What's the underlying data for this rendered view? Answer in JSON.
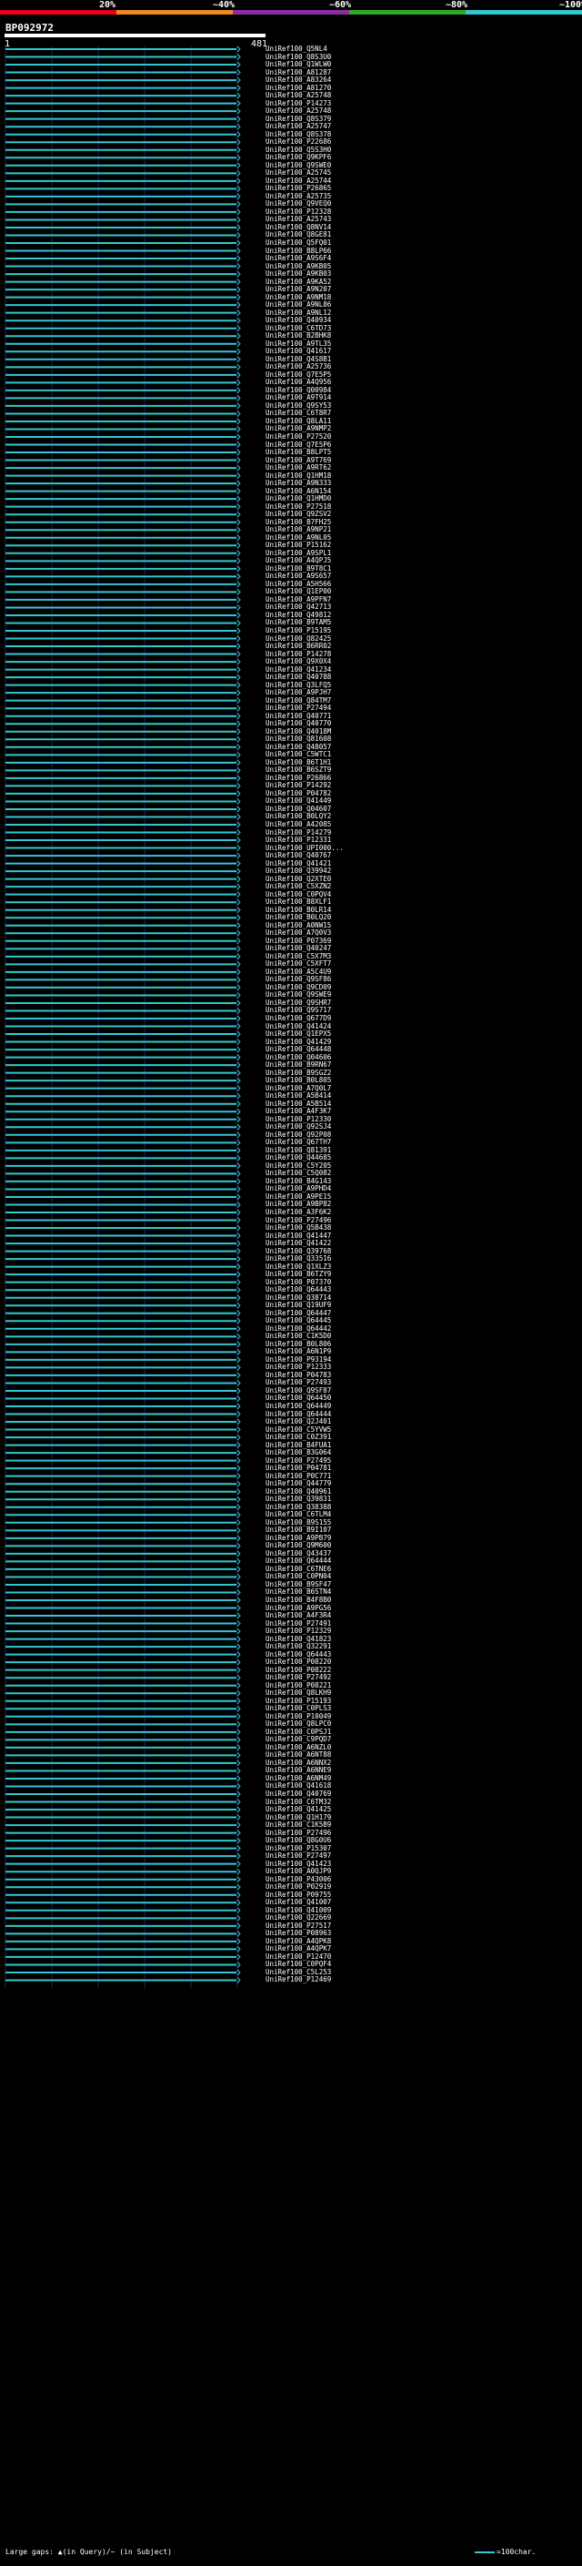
{
  "scale": {
    "labels": [
      "20%",
      "~40%",
      "~60%",
      "~80%",
      "~100%"
    ],
    "colors": [
      "#e8001c",
      "#f08a1e",
      "#8c2ca0",
      "#2fa82f",
      "#32c8d2"
    ]
  },
  "query": {
    "id": "BP092972",
    "start": "1",
    "end": "481"
  },
  "hit_color": "#32c8d2",
  "hits": [
    "UniRef100_Q5NL4",
    "UniRef100_Q8S3U0",
    "UniRef100_Q1WLW0",
    "UniRef100_A81287",
    "UniRef100_A83264",
    "UniRef100_A81270",
    "UniRef100_A25748",
    "UniRef100_P14273",
    "UniRef100_A25748",
    "UniRef100_Q8S379",
    "UniRef100_A25747",
    "UniRef100_Q8S378",
    "UniRef100_P22686",
    "UniRef100_Q5S3H0",
    "UniRef100_Q9KPF6",
    "UniRef100_Q9SWE0",
    "UniRef100_A25745",
    "UniRef100_A25744",
    "UniRef100_P26865",
    "UniRef100_A25735",
    "UniRef100_Q9VEQ0",
    "UniRef100_P12328",
    "UniRef100_A25743",
    "UniRef100_Q8NV14",
    "UniRef100_Q8GE81",
    "UniRef100_Q5FQ01",
    "UniRef100_B8LP66",
    "UniRef100_A9S6F4",
    "UniRef100_A9KB05",
    "UniRef100_A9KB03",
    "UniRef100_A9KA52",
    "UniRef100_A9N207",
    "UniRef100_A9NM18",
    "UniRef100_A9NL86",
    "UniRef100_A9NL12",
    "UniRef100_Q40934",
    "UniRef100_C6TD73",
    "UniRef100_B2BHK8",
    "UniRef100_A9TL35",
    "UniRef100_Q41617",
    "UniRef100_Q4S8B1",
    "UniRef100_A25736",
    "UniRef100_Q7E5P5",
    "UniRef100_A4Q956",
    "UniRef100_Q00984",
    "UniRef100_A9T914",
    "UniRef100_Q9SY53",
    "UniRef100_C6T8R7",
    "UniRef100_Q8LA11",
    "UniRef100_A9NMP2",
    "UniRef100_P27520",
    "UniRef100_Q7E5P6",
    "UniRef100_B8LPT5",
    "UniRef100_A9T769",
    "UniRef100_A9RT62",
    "UniRef100_Q1HM18",
    "UniRef100_A9N333",
    "UniRef100_A6N154",
    "UniRef100_Q1HMD0",
    "UniRef100_P27518",
    "UniRef100_Q9ZSV2",
    "UniRef100_B7FH25",
    "UniRef100_A9NP21",
    "UniRef100_A9NL05",
    "UniRef100_P15162",
    "UniRef100_A9SPL1",
    "UniRef100_A4QPJ5",
    "UniRef100_B9T8C1",
    "UniRef100_A9S657",
    "UniRef100_A5H566",
    "UniRef100_Q1EP00",
    "UniRef100_A9PFN7",
    "UniRef100_Q42713",
    "UniRef100_Q49812",
    "UniRef100_B9TAM5",
    "UniRef100_P15195",
    "UniRef100_Q82425",
    "UniRef100_B6RR02",
    "UniRef100_P14278",
    "UniRef100_Q9X0X4",
    "UniRef100_Q41234",
    "UniRef100_Q40788",
    "UniRef100_Q3LFQ5",
    "UniRef100_A9PJH7",
    "UniRef100_Q84TM7",
    "UniRef100_P27494",
    "UniRef100_Q40771",
    "UniRef100_Q40770",
    "UniRef100_Q4018M",
    "UniRef100_Q81608",
    "UniRef100_Q48057",
    "UniRef100_C5WTC1",
    "UniRef100_B6T1H1",
    "UniRef100_B6SZT9",
    "UniRef100_P26866",
    "UniRef100_P14292",
    "UniRef100_P04782",
    "UniRef100_Q41449",
    "UniRef100_Q04607",
    "UniRef100_B0LQY2",
    "UniRef100_A42085",
    "UniRef100_P14279",
    "UniRef100_P12331",
    "UniRef100_UPI000...",
    "UniRef100_Q40767",
    "UniRef100_Q41421",
    "UniRef100_Q39942",
    "UniRef100_Q2XTE0",
    "UniRef100_C5XZN2",
    "UniRef100_C0PQV4",
    "UniRef100_B8XLF1",
    "UniRef100_B0LR14",
    "UniRef100_B0LQ20",
    "UniRef100_A0NW15",
    "UniRef100_A7Q0V3",
    "UniRef100_P07369",
    "UniRef100_Q40247",
    "UniRef100_C5X7M3",
    "UniRef100_C5XFT7",
    "UniRef100_A5C4U9",
    "UniRef100_Q9SF86",
    "UniRef100_Q9CD09",
    "UniRef100_Q9SWE9",
    "UniRef100_Q9SHR7",
    "UniRef100_Q9S717",
    "UniRef100_Q677D9",
    "UniRef100_Q41424",
    "UniRef100_Q1EPX5",
    "UniRef100_Q41429",
    "UniRef100_Q64448",
    "UniRef100_Q04606",
    "UniRef100_B9RN67",
    "UniRef100_B9SGZ2",
    "UniRef100_B0L805",
    "UniRef100_A7Q0L7",
    "UniRef100_A5B414",
    "UniRef100_A5B514",
    "UniRef100_A4F3K7",
    "UniRef100_P12330",
    "UniRef100_Q92SJ4",
    "UniRef100_Q92P08",
    "UniRef100_Q67TH7",
    "UniRef100_Q81391",
    "UniRef100_Q44685",
    "UniRef100_C5Y205",
    "UniRef100_C5Q082",
    "UniRef100_B4G143",
    "UniRef100_A9PHD4",
    "UniRef100_A9PE15",
    "UniRef100_A9BP82",
    "UniRef100_A3F6K2",
    "UniRef100_P27496",
    "UniRef100_Q5B438",
    "UniRef100_Q41447",
    "UniRef100_Q41422",
    "UniRef100_Q39768",
    "UniRef100_Q33516",
    "UniRef100_Q1XLZ3",
    "UniRef100_B6TZY9",
    "UniRef100_P07370",
    "UniRef100_Q64443",
    "UniRef100_Q38714",
    "UniRef100_Q19UF9",
    "UniRef100_Q64447",
    "UniRef100_Q64445",
    "UniRef100_Q64442",
    "UniRef100_C1K5D0",
    "UniRef100_B0L806",
    "UniRef100_A6N1P9",
    "UniRef100_P93194",
    "UniRef100_P12333",
    "UniRef100_P04783",
    "UniRef100_P27493",
    "UniRef100_Q9SF87",
    "UniRef100_Q64450",
    "UniRef100_Q64449",
    "UniRef100_Q64444",
    "UniRef100_Q2J401",
    "UniRef100_C5YVW5",
    "UniRef100_C0Z391",
    "UniRef100_B4FUA1",
    "UniRef100_B3G064",
    "UniRef100_P27495",
    "UniRef100_P04781",
    "UniRef100_P0C771",
    "UniRef100_Q44779",
    "UniRef100_Q40961",
    "UniRef100_Q39831",
    "UniRef100_Q38388",
    "UniRef100_C6TLM4",
    "UniRef100_B9S155",
    "UniRef100_B9I107",
    "UniRef100_A9PB79",
    "UniRef100_Q9M600",
    "UniRef100_Q43437",
    "UniRef100_Q64444",
    "UniRef100_C6TNE6",
    "UniRef100_C0PN04",
    "UniRef100_B9SF47",
    "UniRef100_B6STN4",
    "UniRef100_B4F8B0",
    "UniRef100_A9PG56",
    "UniRef100_A4F3R4",
    "UniRef100_P27491",
    "UniRef100_P12329",
    "UniRef100_Q41823",
    "UniRef100_Q32291",
    "UniRef100_Q64443",
    "UniRef100_P08220",
    "UniRef100_P08222",
    "UniRef100_P27492",
    "UniRef100_P08221",
    "UniRef100_Q8LKH9",
    "UniRef100_P15193",
    "UniRef100_C0PLS3",
    "UniRef100_P10049",
    "UniRef100_Q8LPC0",
    "UniRef100_C0PSJ1",
    "UniRef100_C9PQD7",
    "UniRef100_A6NZL0",
    "UniRef100_A6NT88",
    "UniRef100_A6NNX2",
    "UniRef100_A6NNE9",
    "UniRef100_A6NM49",
    "UniRef100_Q41618",
    "UniRef100_Q40769",
    "UniRef100_C6TM32",
    "UniRef100_Q41425",
    "UniRef100_Q1H179",
    "UniRef100_C1K5B9",
    "UniRef100_P27496",
    "UniRef100_Q8G0U6",
    "UniRef100_P15307",
    "UniRef100_P27497",
    "UniRef100_Q41423",
    "UniRef100_A0QJP9",
    "UniRef100_P43006",
    "UniRef100_P02919",
    "UniRef100_P09755",
    "UniRef100_Q41007",
    "UniRef100_Q41009",
    "UniRef100_Q22669",
    "UniRef100_P27517",
    "UniRef100_P08963",
    "UniRef100_A4QPK8",
    "UniRef100_A4QPK7",
    "UniRef100_P12470",
    "UniRef100_C0PQF4",
    "UniRef100_C5L253",
    "UniRef100_P12469"
  ],
  "legend": {
    "gaps": "Large gaps: ▲(in Query)/~ (in Subject)",
    "scale": "=100char."
  }
}
